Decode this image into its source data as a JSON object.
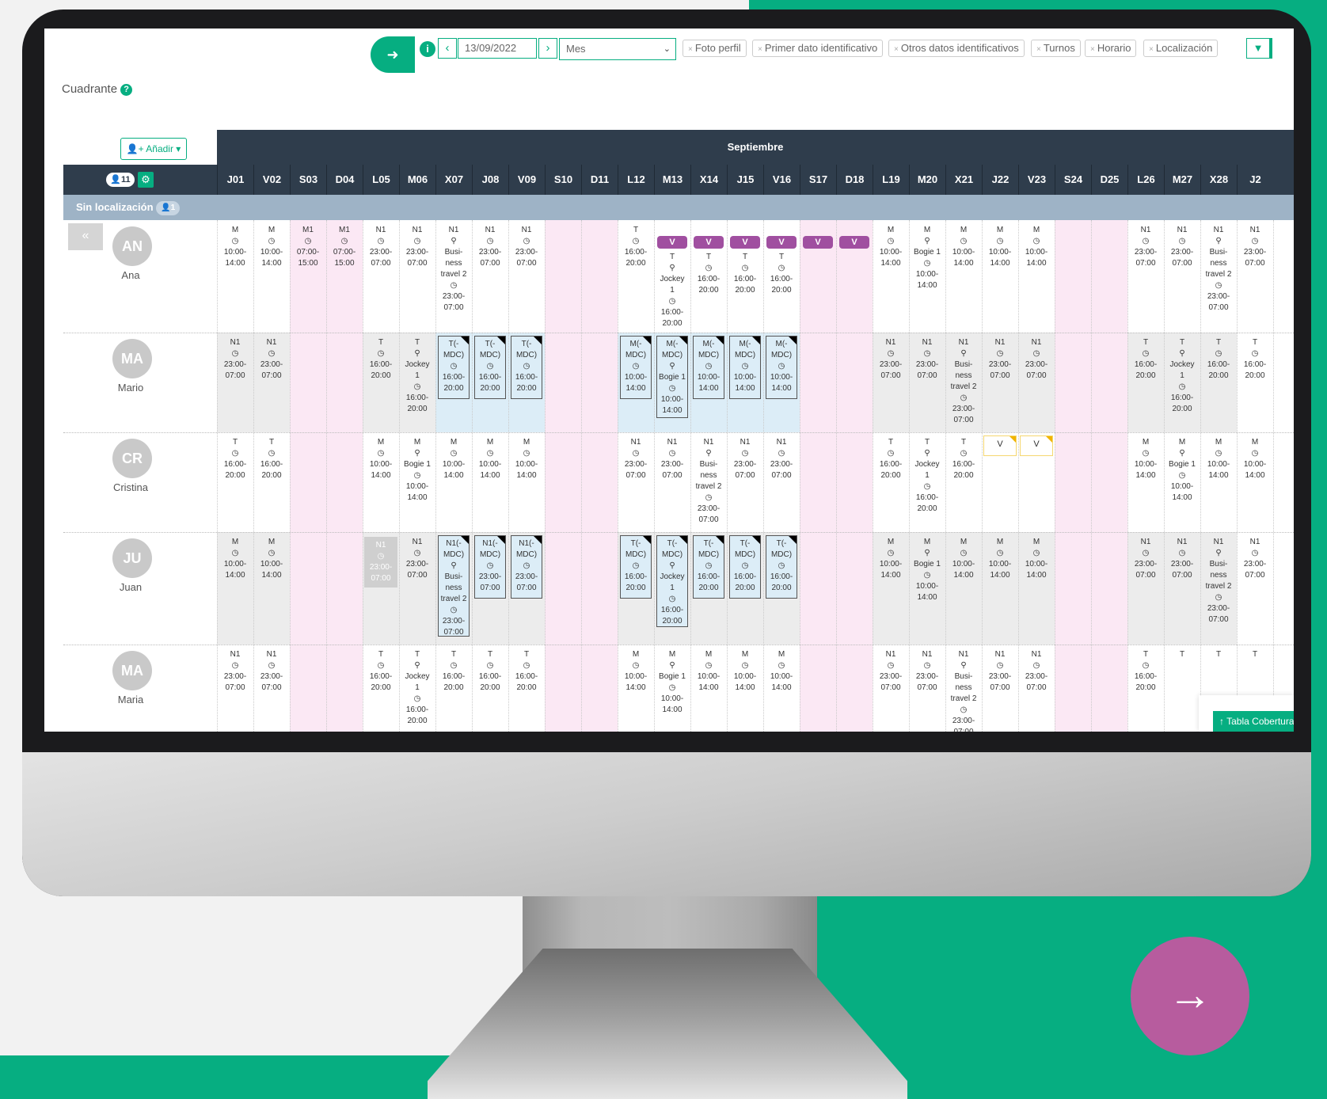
{
  "toolbar": {
    "date": "13/09/2022",
    "period": "Mes",
    "chips": [
      "Foto perfil",
      "Primer dato identificativo",
      "Otros datos identificativos",
      "Turnos",
      "Horario",
      "Localización"
    ]
  },
  "page_title": "Cuadrante",
  "add_button": "Añadir",
  "month": "Septiembre",
  "head_badge": "11",
  "location_group": "Sin localización",
  "location_badge": "1",
  "days": [
    "J01",
    "V02",
    "S03",
    "D04",
    "L05",
    "M06",
    "X07",
    "J08",
    "V09",
    "S10",
    "D11",
    "L12",
    "M13",
    "X14",
    "J15",
    "V16",
    "S17",
    "D18",
    "L19",
    "M20",
    "X21",
    "J22",
    "V23",
    "S24",
    "D25",
    "L26",
    "M27",
    "X28",
    "J2"
  ],
  "people": [
    {
      "initials": "AN",
      "name": "Ana"
    },
    {
      "initials": "MA",
      "name": "Mario"
    },
    {
      "initials": "CR",
      "name": "Cristina"
    },
    {
      "initials": "JU",
      "name": "Juan"
    },
    {
      "initials": "MA",
      "name": "Maria"
    }
  ],
  "cells": {
    "M": "M\n◷\n10:00-\n14:00",
    "N1": "N1\n◷\n23:00-\n07:00",
    "T": "T\n◷\n16:00-\n20:00",
    "M1": "M1\n◷\n07:00-\n15:00",
    "N1bus": "N1\n⚲\nBusi-\nness\ntravel 2\n◷\n23:00-\n07:00",
    "Mbogie": "M\n⚲\nBogie 1\n◷\n10:00-\n14:00",
    "Tjockey": "T\n⚲\nJockey\n1\n◷\n16:00-\n20:00",
    "TMDC": "T(-\nMDC)\n◷\n16:00-\n20:00",
    "MMDC": "M(-\nMDC)\n◷\n10:00-\n14:00",
    "MMDCbogie": "M(-\nMDC)\n⚲\nBogie 1\n◷\n10:00-\n14:00",
    "N1MDCbus": "N1(-\nMDC)\n⚲\nBusi-\nness\ntravel 2\n◷\n23:00-\n07:00",
    "N1MDC": "N1(-\nMDC)\n◷\n23:00-\n07:00",
    "TMDCjockey": "T(-\nMDC)\n⚲\nJockey\n1\n◷\n16:00-\n20:00",
    "Ttop": "T",
    "V": "V"
  },
  "tabla_button": "Tabla Cobertura",
  "colors": {
    "brand": "#06ae81",
    "header": "#2f3d4c",
    "vacation": "#a04fa0",
    "weekend": "#fbe8f4",
    "next": "#b75c9e"
  }
}
